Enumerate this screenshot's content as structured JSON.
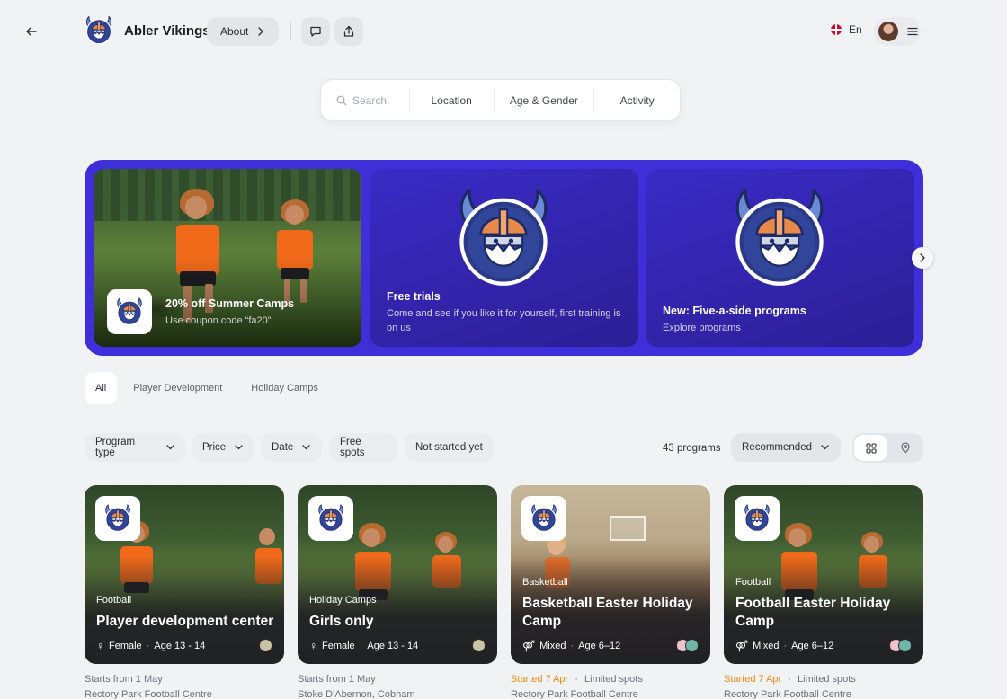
{
  "header": {
    "club_name": "Abler Vikings",
    "about_label": "About",
    "language": "En"
  },
  "search": {
    "placeholder": "Search",
    "location": "Location",
    "age_gender": "Age & Gender",
    "activity": "Activity"
  },
  "promos": [
    {
      "title": "20% off Summer Camps",
      "subtitle": "Use coupon code “fa20”"
    },
    {
      "title": "Free trials",
      "subtitle": "Come and see if you like it for yourself, first training is on us"
    },
    {
      "title": "New: Five-a-side programs",
      "subtitle": "Explore programs"
    }
  ],
  "tabs": [
    "All",
    "Player Development",
    "Holiday Camps"
  ],
  "filters": {
    "program_type": "Program type",
    "price": "Price",
    "date": "Date",
    "free_spots": "Free spots",
    "not_started": "Not started yet",
    "count": "43 programs",
    "sort": "Recommended"
  },
  "programs": [
    {
      "category": "Football",
      "title": "Player development center",
      "gender": "Female",
      "age": "Age 13 - 14",
      "start": "Starts from 1 May",
      "spots": "",
      "location": "Rectory Park Football Centre"
    },
    {
      "category": "Holiday Camps",
      "title": "Girls only",
      "gender": "Female",
      "age": "Age 13 - 14",
      "start": "Starts from 1 May",
      "spots": "",
      "location": "Stoke D'Abernon, Cobham"
    },
    {
      "category": "Basketball",
      "title": "Basketball Easter Holiday Camp",
      "gender": "Mixed",
      "age": "Age 6–12",
      "start": "Started 7 Apr",
      "spots": "Limited spots",
      "location": "Rectory Park Football Centre"
    },
    {
      "category": "Football",
      "title": "Football Easter Holiday Camp",
      "gender": "Mixed",
      "age": "Age 6–12",
      "start": "Started 7 Apr",
      "spots": "Limited spots",
      "location": "Rectory Park Football Centre"
    }
  ],
  "logo_text": "ABLER VIKINGS",
  "colors": {
    "accent": "#3f2fd8",
    "orange": "#f08a16"
  }
}
